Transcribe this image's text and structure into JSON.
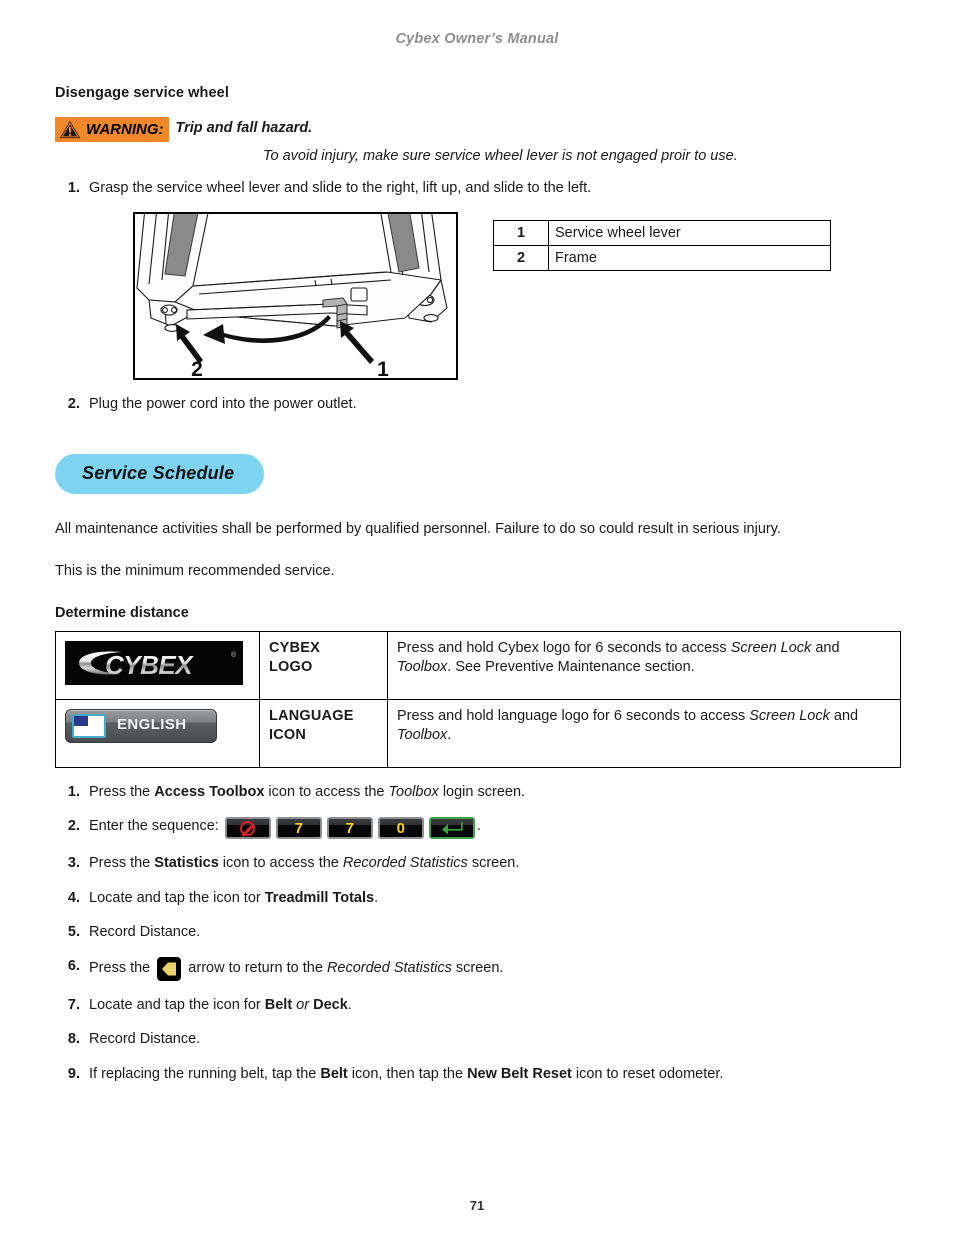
{
  "running_head": "Cybex Owner’s Manual",
  "section_heading": "Disengage service wheel",
  "warning": {
    "icon": "warning-triangle-icon",
    "label": "WARNING:",
    "headline": "Trip and fall hazard.",
    "detail": "To avoid injury, make sure service wheel lever is not engaged proir to use.",
    "background_color": "#F0882B"
  },
  "steps_top": [
    {
      "num": "1.",
      "text": "Grasp the service wheel lever and slide to the right, lift up, and slide to the left."
    },
    {
      "num": "2.",
      "text": "Plug the power cord into the power outlet."
    }
  ],
  "figure": {
    "name": "treadmill-rear-service-wheel-illustration",
    "callout_1": "1",
    "callout_2": "2"
  },
  "legend": {
    "rows": [
      {
        "index": "1",
        "label": "Service wheel lever"
      },
      {
        "index": "2",
        "label": "Frame"
      }
    ]
  },
  "service_schedule": {
    "pill_label": "Service Schedule",
    "pill_color": "#7DD3F0",
    "paragraph_1": "All maintenance activities shall be performed by qualified personnel. Failure to do so could result in serious injury.",
    "paragraph_2": "This is the minimum recommended service."
  },
  "determine_distance": {
    "heading": "Determine distance",
    "table": {
      "rows": [
        {
          "icon": "cybex-logo-icon",
          "icon_text": "CYBEX",
          "name": "CYBEX LOGO",
          "name_line1": "CYBEX",
          "name_line2": "LOGO",
          "desc_part1": "Press and hold Cybex logo for 6 seconds to access ",
          "desc_em1": "Screen Lock",
          "desc_part2": " and ",
          "desc_em2": "Toolbox",
          "desc_part3": ". See Preventive Maintenance section."
        },
        {
          "icon": "language-flag-icon",
          "icon_text": "ENGLISH",
          "name": "LANGUAGE ICON",
          "name_line1": "LANGUAGE",
          "name_line2": "ICON",
          "desc_part1": "Press and hold language logo for 6 seconds to access ",
          "desc_em1": "Screen Lock",
          "desc_part2": " and ",
          "desc_em2": "Toolbox",
          "desc_part3": "."
        }
      ]
    }
  },
  "procedure": {
    "step1": {
      "num": "1.",
      "a": "Press the ",
      "bold": "Access Toolbox",
      "b": " icon to access the ",
      "em": "Toolbox",
      "c": " login screen."
    },
    "step2": {
      "num": "2.",
      "a": "Enter the sequence:",
      "keys": [
        {
          "name": "no-entry-key",
          "type": "nosign",
          "label": ""
        },
        {
          "name": "seven-key",
          "type": "num",
          "label": "7"
        },
        {
          "name": "seven-key",
          "type": "num",
          "label": "7"
        },
        {
          "name": "zero-key",
          "type": "num",
          "label": "0"
        },
        {
          "name": "enter-key",
          "type": "enter",
          "label": "↵"
        }
      ],
      "c": "."
    },
    "step3": {
      "num": "3.",
      "a": "Press the ",
      "bold": "Statistics",
      "b": " icon to access the ",
      "em": "Recorded Statistics",
      "c": " screen."
    },
    "step4": {
      "num": "4.",
      "a": "Locate and tap the icon tor ",
      "bold": "Treadmill Totals",
      "c": "."
    },
    "step5": {
      "num": "5.",
      "a": "Record Distance."
    },
    "step6": {
      "num": "6.",
      "a": "Press the ",
      "icon": "back-arrow-icon",
      "b": " arrow to return to the ",
      "em": "Recorded Statistics",
      "c": " screen."
    },
    "step7": {
      "num": "7.",
      "a": "Locate and tap the icon for ",
      "bold": "Belt",
      "em": " or ",
      "bold2": "Deck",
      "c": "."
    },
    "step8": {
      "num": "8.",
      "a": "Record Distance."
    },
    "step9": {
      "num": "9.",
      "a": "If replacing the running belt, tap the ",
      "bold": "Belt",
      "b": " icon, then tap the ",
      "bold2": "New Belt Reset",
      "c": " icon to reset odometer."
    }
  },
  "folio": "71"
}
